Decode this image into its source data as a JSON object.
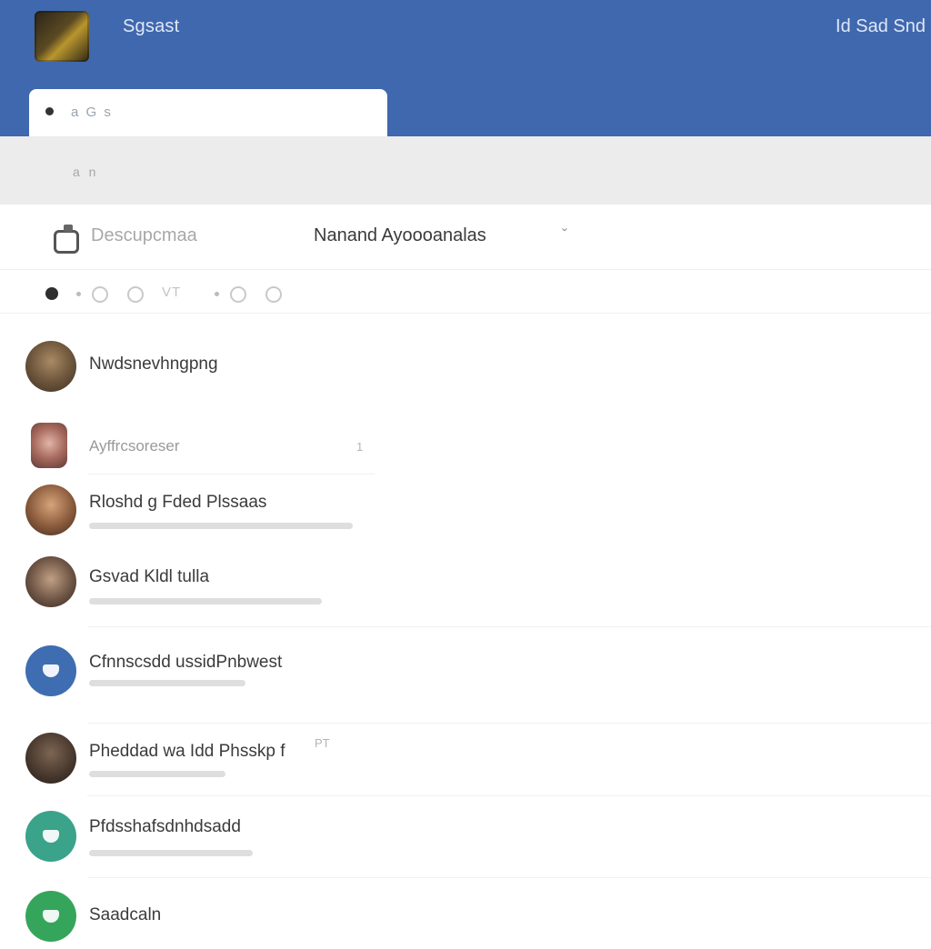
{
  "header": {
    "logo_icon": "app-logo-icon",
    "title": "Sgsast",
    "right_text": "Id Sad Snd",
    "background": "#3f68ae"
  },
  "tab": {
    "label": "a G s"
  },
  "address_bar": {
    "text": "a n"
  },
  "toolbar": {
    "brand_icon": "chat-bubble-icon",
    "brand_label": "Descupcmaa",
    "page_heading": "Nanand Ayoooanalas",
    "heading_chevron": "ˇ"
  },
  "icon_row": {
    "text": "VT"
  },
  "contacts": [
    {
      "name": "Nwdsnevhngpng",
      "avatar": "photo1",
      "preview_visible": false,
      "aside": ""
    },
    {
      "name": "Ayffrcsoreser",
      "avatar": "photo2",
      "preview_visible": false,
      "aside": "1"
    },
    {
      "name": "Rloshd g Fded Plssaas",
      "avatar": "photo3",
      "preview_visible": true,
      "aside": ""
    },
    {
      "name": "Gsvad Kldl tulla",
      "avatar": "photo4",
      "preview_visible": true,
      "aside": ""
    },
    {
      "name": "Cfnnscsdd ussidPnbwest",
      "avatar": "blue",
      "preview_visible": true,
      "aside": ""
    },
    {
      "name": "Pheddad wa Idd Phsskp f",
      "avatar": "photo5",
      "preview_visible": true,
      "aside": "PT"
    },
    {
      "name": "Pfdsshafsdnhdsadd",
      "avatar": "green",
      "preview_visible": true,
      "aside": ""
    },
    {
      "name": "Saadcaln",
      "avatar": "green2",
      "preview_visible": false,
      "aside": ""
    }
  ],
  "colors": {
    "accent": "#3f68ae",
    "avatar_blue": "#3f6db1",
    "avatar_green": "#3aa38a",
    "avatar_green_alt": "#35a55b"
  }
}
